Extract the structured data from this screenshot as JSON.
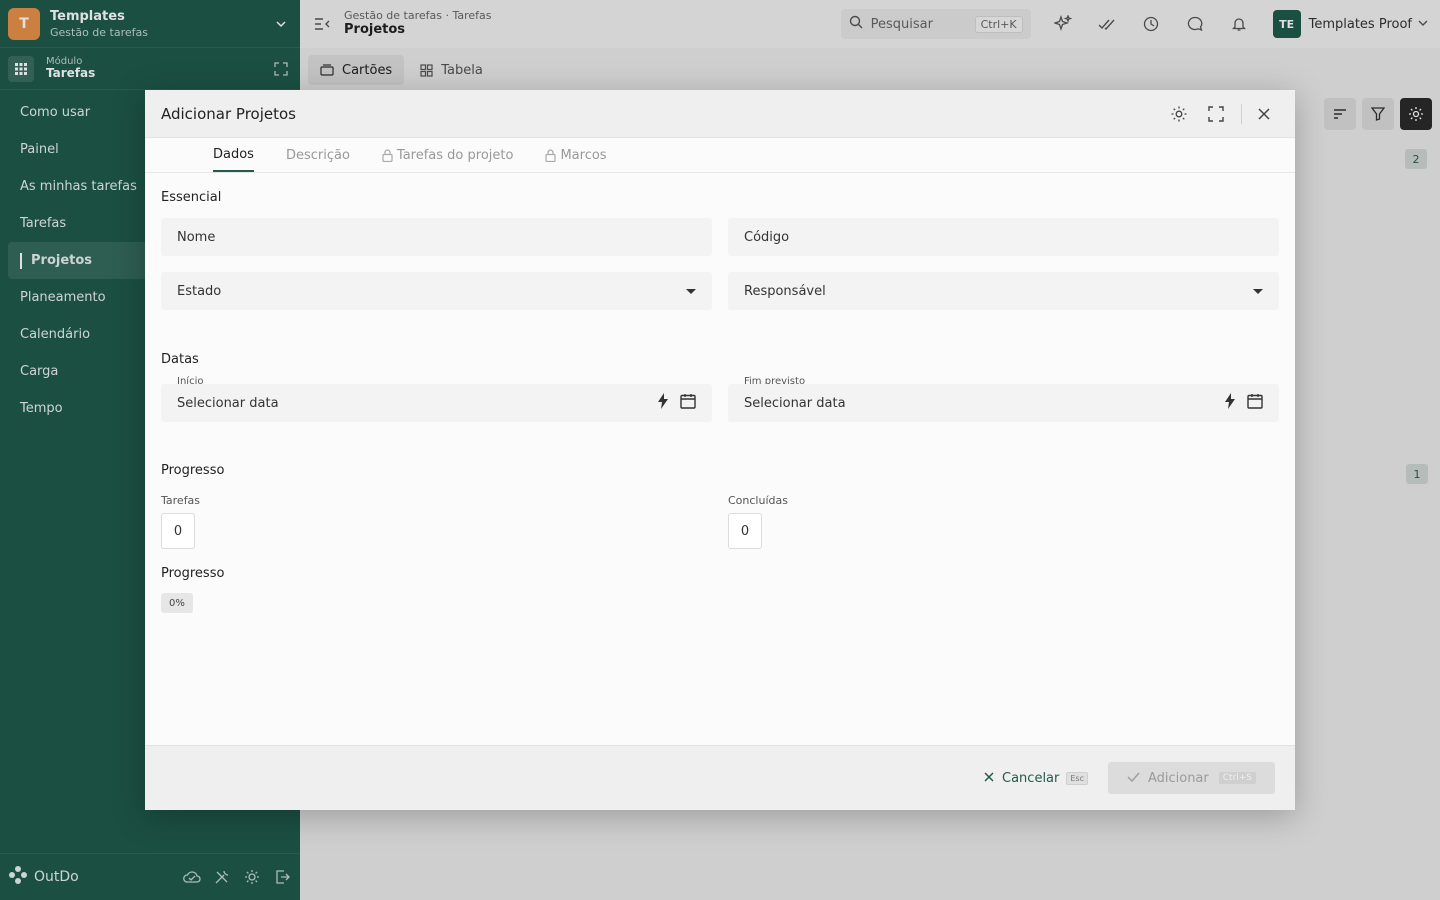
{
  "workspace": {
    "initial": "T",
    "title": "Templates",
    "subtitle": "Gestão de tarefas"
  },
  "module": {
    "caption": "Módulo",
    "name": "Tarefas"
  },
  "nav": [
    {
      "label": "Como usar"
    },
    {
      "label": "Painel"
    },
    {
      "label": "As minhas tarefas"
    },
    {
      "label": "Tarefas"
    },
    {
      "label": "Projetos",
      "active": true
    },
    {
      "label": "Planeamento"
    },
    {
      "label": "Calendário"
    },
    {
      "label": "Carga"
    },
    {
      "label": "Tempo"
    }
  ],
  "brand": {
    "name": "OutDo"
  },
  "topbar": {
    "breadcrumb": "Gestão de tarefas · Tarefas",
    "title": "Projetos",
    "search_label": "Pesquisar",
    "search_shortcut": "Ctrl+K",
    "user_initials": "TE",
    "user_name": "Templates Proof"
  },
  "views": {
    "cards": "Cartões",
    "table": "Tabela"
  },
  "badges": {
    "first": "2",
    "second": "1"
  },
  "modal": {
    "title": "Adicionar Projetos",
    "tabs": [
      "Dados",
      "Descrição",
      "Tarefas do projeto",
      "Marcos"
    ],
    "sections": {
      "essential": "Essencial",
      "dates": "Datas",
      "progress": "Progresso",
      "progress2": "Progresso"
    },
    "fields": {
      "name": "Nome",
      "code": "Código",
      "state": "Estado",
      "responsible": "Responsável",
      "start_label": "Início",
      "start_value": "Selecionar data",
      "end_label": "Fim previsto",
      "end_value": "Selecionar data",
      "tasks_label": "Tarefas",
      "tasks_value": "0",
      "done_label": "Concluídas",
      "done_value": "0",
      "progress_value": "0%"
    },
    "footer": {
      "cancel": "Cancelar",
      "cancel_key": "Esc",
      "add": "Adicionar",
      "add_key": "Ctrl+S"
    }
  },
  "colors": {
    "primary": "#1f5a4c",
    "accent": "#e8914a"
  }
}
